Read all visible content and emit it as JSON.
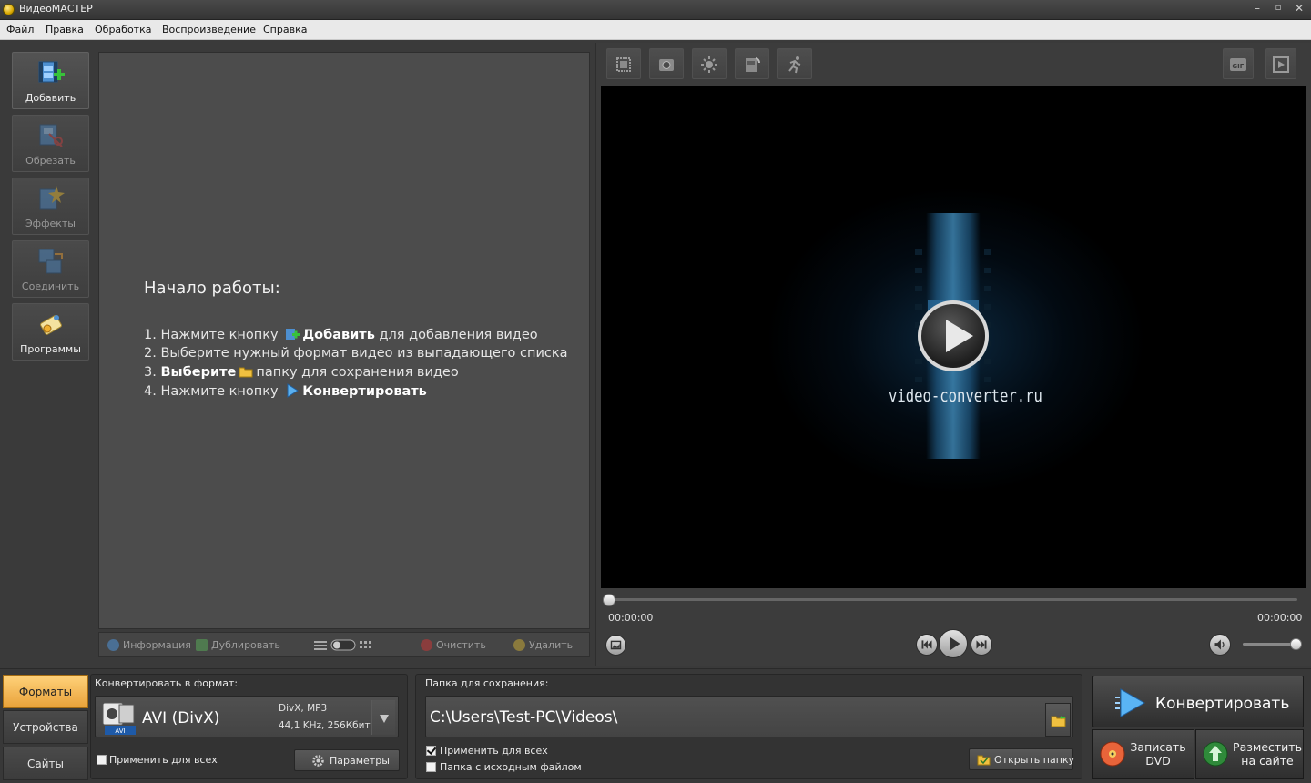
{
  "window": {
    "title": "ВидеоМАСТЕР",
    "minimize": "–",
    "restore": "▫",
    "close": "✕"
  },
  "menu": [
    "Файл",
    "Правка",
    "Обработка",
    "Воспроизведение",
    "Справка"
  ],
  "sidebar": {
    "items": [
      {
        "label": "Добавить",
        "enabled": true
      },
      {
        "label": "Обрезать",
        "enabled": false
      },
      {
        "label": "Эффекты",
        "enabled": false
      },
      {
        "label": "Соединить",
        "enabled": false
      },
      {
        "label": "Программы",
        "enabled": true
      }
    ]
  },
  "start": {
    "title": "Начало работы:",
    "step1_a": "1. Нажмите кнопку",
    "step1_b": "Добавить",
    "step1_c": "для добавления видео",
    "step2": "2. Выберите нужный формат видео из выпадающего списка",
    "step3_a": "3.",
    "step3_b": "Выберите",
    "step3_c": "папку для сохранения видео",
    "step4_a": "4. Нажмите кнопку",
    "step4_b": "Конвертировать"
  },
  "list_toolbar": {
    "info": "Информация",
    "duplicate": "Дублировать",
    "clear": "Очистить",
    "delete": "Удалить"
  },
  "preview_toolbar": {
    "icons": [
      "crop-icon",
      "camera-icon",
      "brightness-icon",
      "rotate-icon",
      "speed-icon"
    ],
    "right_icons": [
      "gif-icon",
      "fullscreen-icon"
    ],
    "gif_label": "GIF"
  },
  "player": {
    "watermark": "video-converter.ru",
    "time_current": "00:00:00",
    "time_total": "00:00:00",
    "position": 0,
    "volume": 1.0
  },
  "bottom_tabs": [
    {
      "label": "Форматы",
      "active": true
    },
    {
      "label": "Устройства",
      "active": false
    },
    {
      "label": "Сайты",
      "active": false
    }
  ],
  "format": {
    "caption": "Конвертировать в формат:",
    "name": "AVI (DivX)",
    "badge": "AVI",
    "detail1": "DivX, MP3",
    "detail2": "44,1 KHz, 256Кбит",
    "apply_all": "Применить для всех",
    "apply_all_checked": false,
    "params": "Параметры"
  },
  "save": {
    "caption": "Папка для сохранения:",
    "path": "C:\\Users\\Test-PC\\Videos\\",
    "apply_all": "Применить для всех",
    "apply_all_checked": true,
    "source_folder": "Папка с исходным файлом",
    "source_folder_checked": false,
    "open_folder": "Открыть папку"
  },
  "actions": {
    "convert": "Конвертировать",
    "dvd_line1": "Записать",
    "dvd_line2": "DVD",
    "web_line1": "Разместить",
    "web_line2": "на сайте"
  },
  "colors": {
    "accent_tab": "#e9a23a",
    "background": "#3a3a3a",
    "video_glow": "#46a0d8"
  }
}
